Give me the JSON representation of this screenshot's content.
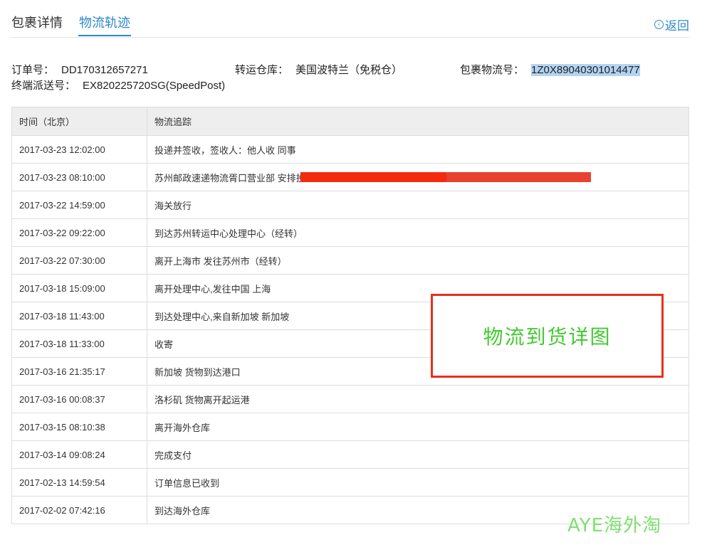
{
  "tabs": {
    "details": "包裹详情",
    "tracking": "物流轨迹"
  },
  "back_label": "返回",
  "order": {
    "order_no_label": "订单号：",
    "order_no": "DD170312657271",
    "warehouse_label": "转运仓库：",
    "warehouse": "美国波特兰（免税仓）",
    "parcel_no_label": "包裹物流号：",
    "parcel_no": "1Z0X89040301014477",
    "delivery_no_label": "终端派送号：",
    "delivery_no": "EX820225720SG(SpeedPost)"
  },
  "table": {
    "headers": [
      "时间（北京）",
      "物流追踪"
    ],
    "rows": [
      [
        "2017-03-23 12:02:00",
        "投递并签收，签收人：他人收 同事"
      ],
      [
        "2017-03-23 08:10:00",
        "苏州邮政速递物流胥口营业部 安排投递"
      ],
      [
        "2017-03-22 14:59:00",
        "海关放行"
      ],
      [
        "2017-03-22 09:22:00",
        "到达苏州转运中心处理中心（经转）"
      ],
      [
        "2017-03-22 07:30:00",
        "离开上海市 发往苏州市（经转）"
      ],
      [
        "2017-03-18 15:09:00",
        "离开处理中心,发往中国 上海"
      ],
      [
        "2017-03-18 11:43:00",
        "到达处理中心,来自新加坡 新加坡"
      ],
      [
        "2017-03-18 11:33:00",
        "收寄"
      ],
      [
        "2017-03-16 21:35:17",
        "新加坡 货物到达港口"
      ],
      [
        "2017-03-16 00:08:37",
        "洛杉矶 货物离开起运港"
      ],
      [
        "2017-03-15 08:10:38",
        "离开海外仓库"
      ],
      [
        "2017-03-14 09:08:24",
        "完成支付"
      ],
      [
        "2017-02-13 14:59:54",
        "订单信息已收到"
      ],
      [
        "2017-02-02 07:42:16",
        "到达海外仓库"
      ]
    ]
  },
  "annotation": "物流到货详图",
  "watermark": "AYE海外淘",
  "colors": {
    "accent": "#2b88c9",
    "callout_border": "#e8301b",
    "annotation_text": "#44c933",
    "redaction": "#f42a0e"
  }
}
